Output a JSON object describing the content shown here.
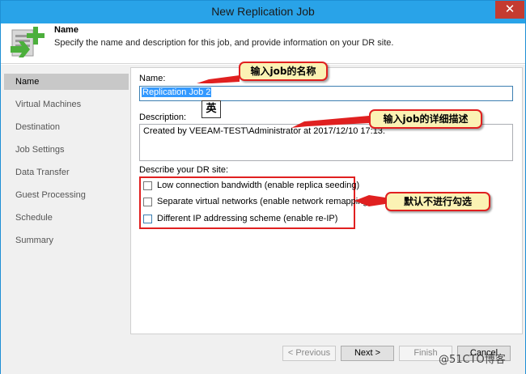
{
  "window": {
    "title": "New Replication Job",
    "close_glyph": "✕"
  },
  "header": {
    "title": "Name",
    "description": "Specify the name and description for this job, and provide information on your DR site.",
    "icon": "replication-job-icon"
  },
  "sidebar": {
    "items": [
      {
        "label": "Name",
        "active": true
      },
      {
        "label": "Virtual Machines",
        "active": false
      },
      {
        "label": "Destination",
        "active": false
      },
      {
        "label": "Job Settings",
        "active": false
      },
      {
        "label": "Data Transfer",
        "active": false
      },
      {
        "label": "Guest Processing",
        "active": false
      },
      {
        "label": "Schedule",
        "active": false
      },
      {
        "label": "Summary",
        "active": false
      }
    ]
  },
  "form": {
    "name_label": "Name:",
    "name_value": "Replication Job 2",
    "description_label": "Description:",
    "description_value": "Created by VEEAM-TEST\\Administrator at 2017/12/10 17:13.",
    "dr_site_label": "Describe your DR site:",
    "options": [
      {
        "label": "Low connection bandwidth (enable replica seeding)",
        "checked": false
      },
      {
        "label": "Separate virtual networks (enable network remapping)",
        "checked": false
      },
      {
        "label": "Different IP addressing scheme (enable re-IP)",
        "checked": false
      }
    ]
  },
  "ime_indicator": "英",
  "annotations": {
    "name_callout": "输入job的名称",
    "desc_callout": "输入job的详细描述",
    "options_callout": "默认不进行勾选"
  },
  "buttons": {
    "previous": "< Previous",
    "next": "Next >",
    "finish": "Finish",
    "cancel": "Cancel"
  },
  "watermark": "@51CTO博客",
  "colors": {
    "titlebar": "#29a3e8",
    "close_button": "#c43b31",
    "annotation_border": "#e02020",
    "annotation_fill": "#fbf2b4",
    "selection": "#3399ff"
  }
}
